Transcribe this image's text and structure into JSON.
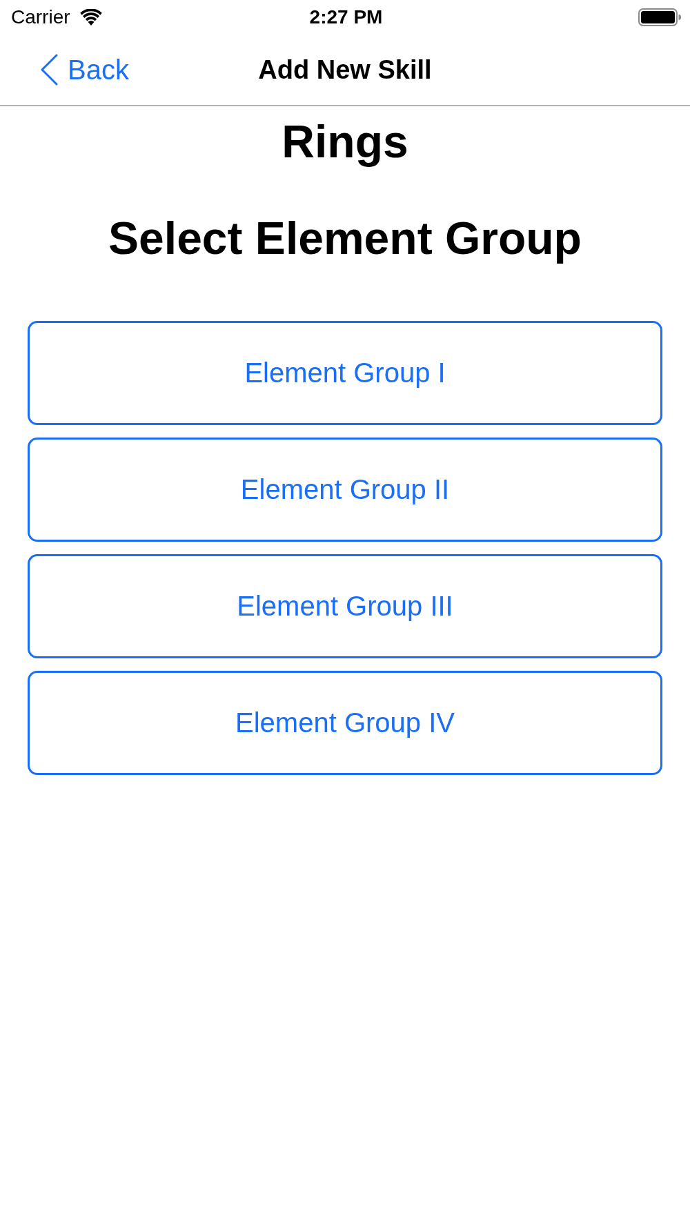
{
  "status_bar": {
    "carrier": "Carrier",
    "time": "2:27 PM"
  },
  "nav_bar": {
    "back_label": "Back",
    "title": "Add New Skill"
  },
  "heading": "Rings",
  "subheading": "Select Element Group",
  "options": [
    {
      "label": "Element Group I"
    },
    {
      "label": "Element Group II"
    },
    {
      "label": "Element Group III"
    },
    {
      "label": "Element Group IV"
    }
  ]
}
